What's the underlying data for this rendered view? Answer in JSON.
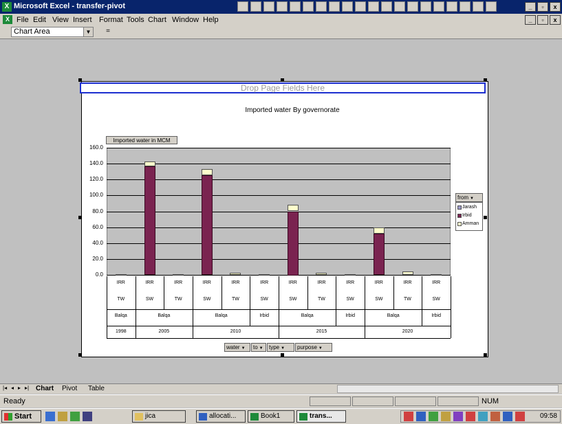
{
  "window": {
    "title": "Microsoft Excel - transfer-pivot",
    "app_icon": "excel-icon"
  },
  "menu": {
    "items": [
      "File",
      "Edit",
      "View",
      "Insert",
      "Format",
      "Tools",
      "Chart",
      "Window",
      "Help"
    ]
  },
  "namebox": {
    "value": "Chart Area",
    "fx": "="
  },
  "chart": {
    "drop_zone": "Drop Page Fields Here",
    "title": "Imported water By governorate",
    "data_field": "Imported water in MCM",
    "legend_field": "from",
    "page_fields": [
      "water",
      "to",
      "type",
      "purpose"
    ]
  },
  "chart_data": {
    "type": "bar",
    "stacked": true,
    "title": "Imported water By governorate",
    "ylabel": "Imported water in MCM",
    "ylim": [
      0,
      160
    ],
    "yticks": [
      "0.0",
      "20.0",
      "40.0",
      "60.0",
      "80.0",
      "100.0",
      "120.0",
      "140.0",
      "160.0"
    ],
    "categories": [
      {
        "purpose": "IRR",
        "type": "TW",
        "to": "Balqa",
        "year": "1998"
      },
      {
        "purpose": "IRR",
        "type": "SW",
        "to": "Balqa",
        "year": "2005"
      },
      {
        "purpose": "IRR",
        "type": "TW",
        "to": "Balqa",
        "year": "2005"
      },
      {
        "purpose": "IRR",
        "type": "SW",
        "to": "Balqa",
        "year": "2010"
      },
      {
        "purpose": "IRR",
        "type": "TW",
        "to": "Balqa",
        "year": "2010"
      },
      {
        "purpose": "IRR",
        "type": "SW",
        "to": "Irbid",
        "year": "2010"
      },
      {
        "purpose": "IRR",
        "type": "SW",
        "to": "Balqa",
        "year": "2015"
      },
      {
        "purpose": "IRR",
        "type": "TW",
        "to": "Balqa",
        "year": "2015"
      },
      {
        "purpose": "IRR",
        "type": "SW",
        "to": "Irbid",
        "year": "2015"
      },
      {
        "purpose": "IRR",
        "type": "SW",
        "to": "Balqa",
        "year": "2020"
      },
      {
        "purpose": "IRR",
        "type": "TW",
        "to": "Balqa",
        "year": "2020"
      },
      {
        "purpose": "IRR",
        "type": "SW",
        "to": "Irbid",
        "year": "2020"
      }
    ],
    "year_groups": [
      {
        "label": "1998",
        "span": 1
      },
      {
        "label": "2005",
        "span": 2
      },
      {
        "label": "2010",
        "span": 3
      },
      {
        "label": "2015",
        "span": 3
      },
      {
        "label": "2020",
        "span": 3
      }
    ],
    "to_groups": [
      {
        "label": "Balqa",
        "span": 1
      },
      {
        "label": "Balqa",
        "span": 2
      },
      {
        "label": "Balqa",
        "span": 2
      },
      {
        "label": "Irbid",
        "span": 1
      },
      {
        "label": "Balqa",
        "span": 2
      },
      {
        "label": "Irbid",
        "span": 1
      },
      {
        "label": "Balqa",
        "span": 2
      },
      {
        "label": "Irbid",
        "span": 1
      }
    ],
    "series": [
      {
        "name": "Irbid",
        "color": "#7a2350",
        "values": [
          0,
          137,
          0,
          125,
          0,
          0,
          80,
          0,
          0,
          52,
          0,
          0
        ]
      },
      {
        "name": "Amman",
        "color": "#ffffcc",
        "values": [
          1,
          6,
          1,
          8,
          3,
          1,
          8,
          3,
          1,
          8,
          4,
          1
        ]
      },
      {
        "name": "Jarash",
        "color": "#9a98c8",
        "values": [
          0,
          0,
          0,
          0,
          0,
          0,
          0,
          0,
          0,
          0,
          0,
          0
        ]
      }
    ],
    "legend": [
      "Jarash",
      "Irbid",
      "Amman"
    ],
    "legend_position": "right"
  },
  "sheet_tabs": [
    "Chart",
    "Pivot",
    "Table"
  ],
  "status": {
    "text": "Ready",
    "num": "NUM"
  },
  "taskbar": {
    "start": "Start",
    "buttons": [
      "jica",
      "allocati...",
      "Book1",
      "trans..."
    ],
    "clock": "09:58"
  }
}
